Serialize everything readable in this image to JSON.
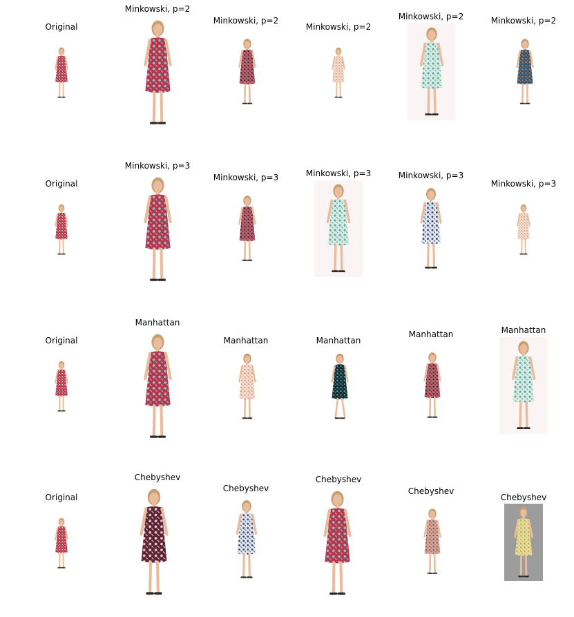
{
  "rows": [
    {
      "cells": [
        {
          "caption": "Original",
          "image": {
            "dress": "#b8344c",
            "pattern": "#e8d8c8",
            "bg": "#ffffff",
            "pose": "stand",
            "subject": "woman-in-red-floral-dress"
          }
        },
        {
          "caption": "Minkowski, p=2",
          "image": {
            "dress": "#b8344c",
            "pattern": "#86c8c8",
            "bg": "#ffffff",
            "pose": "stand",
            "subject": "woman-in-red-floral-dress"
          }
        },
        {
          "caption": "Minkowski, p=2",
          "image": {
            "dress": "#c06070",
            "pattern": "#222222",
            "bg": "#ffffff",
            "pose": "stand",
            "subject": "woman-in-zebra-print-dress"
          }
        },
        {
          "caption": "Minkowski, p=2",
          "image": {
            "dress": "#f0e0c8",
            "pattern": "#e08898",
            "bg": "#ffffff",
            "pose": "stand",
            "subject": "woman-in-cream-floral-dress"
          }
        },
        {
          "caption": "Minkowski, p=2",
          "image": {
            "dress": "#d8ece4",
            "pattern": "#5aa8a0",
            "bg": "#faf4f4",
            "pose": "stand",
            "subject": "woman-in-mint-print-dress"
          }
        },
        {
          "caption": "Minkowski, p=2",
          "image": {
            "dress": "#2c5878",
            "pattern": "#d88050",
            "bg": "#ffffff",
            "pose": "stand",
            "subject": "woman-in-blue-floral-dress"
          }
        }
      ]
    },
    {
      "cells": [
        {
          "caption": "Original",
          "image": {
            "dress": "#b8344c",
            "pattern": "#e8d8c8",
            "bg": "#ffffff",
            "pose": "stand",
            "subject": "woman-in-red-floral-dress"
          }
        },
        {
          "caption": "Minkowski, p=3",
          "image": {
            "dress": "#b8344c",
            "pattern": "#86c8c8",
            "bg": "#ffffff",
            "pose": "stand",
            "subject": "woman-in-red-floral-dress"
          }
        },
        {
          "caption": "Minkowski, p=3",
          "image": {
            "dress": "#c06070",
            "pattern": "#222222",
            "bg": "#ffffff",
            "pose": "stand",
            "subject": "woman-in-zebra-print-dress"
          }
        },
        {
          "caption": "Minkowski, p=3",
          "image": {
            "dress": "#d8ece4",
            "pattern": "#5aa8a0",
            "bg": "#faf4f4",
            "pose": "stand",
            "subject": "woman-in-mint-print-dress"
          }
        },
        {
          "caption": "Minkowski, p=3",
          "image": {
            "dress": "#e4e8f0",
            "pattern": "#2c3c6c",
            "bg": "#ffffff",
            "pose": "stand",
            "subject": "woman-in-navy-print-dress"
          }
        },
        {
          "caption": "Minkowski, p=3",
          "image": {
            "dress": "#f0e0c8",
            "pattern": "#e08898",
            "bg": "#ffffff",
            "pose": "stand",
            "subject": "woman-in-cream-floral-dress"
          }
        }
      ]
    },
    {
      "cells": [
        {
          "caption": "Original",
          "image": {
            "dress": "#b8344c",
            "pattern": "#e8d8c8",
            "bg": "#ffffff",
            "pose": "stand",
            "subject": "woman-in-red-floral-dress"
          }
        },
        {
          "caption": "Manhattan",
          "image": {
            "dress": "#b8344c",
            "pattern": "#86c8c8",
            "bg": "#ffffff",
            "pose": "stand",
            "subject": "woman-in-red-floral-dress"
          }
        },
        {
          "caption": "Manhattan",
          "image": {
            "dress": "#f0e0c8",
            "pattern": "#e08898",
            "bg": "#ffffff",
            "pose": "stand",
            "subject": "woman-in-cream-floral-dress"
          }
        },
        {
          "caption": "Manhattan",
          "image": {
            "dress": "#1c2430",
            "pattern": "#40c0b0",
            "bg": "#ffffff",
            "pose": "walk",
            "subject": "woman-in-dark-print-dress"
          }
        },
        {
          "caption": "Manhattan",
          "image": {
            "dress": "#c06070",
            "pattern": "#222222",
            "bg": "#ffffff",
            "pose": "stand",
            "subject": "woman-in-zebra-print-dress"
          }
        },
        {
          "caption": "Manhattan",
          "image": {
            "dress": "#d8ece4",
            "pattern": "#5aa8a0",
            "bg": "#faf4f4",
            "pose": "stand",
            "subject": "woman-in-mint-print-dress"
          }
        }
      ]
    },
    {
      "cells": [
        {
          "caption": "Original",
          "image": {
            "dress": "#b8344c",
            "pattern": "#e8d8c8",
            "bg": "#ffffff",
            "pose": "stand",
            "subject": "woman-in-red-floral-dress"
          }
        },
        {
          "caption": "Chebyshev",
          "image": {
            "dress": "#5a2434",
            "pattern": "#e8c8cc",
            "bg": "#ffffff",
            "pose": "stand",
            "subject": "woman-in-burgundy-dress"
          }
        },
        {
          "caption": "Chebyshev",
          "image": {
            "dress": "#e4e8f0",
            "pattern": "#2c3c6c",
            "bg": "#ffffff",
            "pose": "stand",
            "subject": "woman-in-navy-print-dress"
          }
        },
        {
          "caption": "Chebyshev",
          "image": {
            "dress": "#b8344c",
            "pattern": "#86c8c8",
            "bg": "#ffffff",
            "pose": "stand",
            "subject": "woman-in-red-floral-dress"
          }
        },
        {
          "caption": "Chebyshev",
          "image": {
            "dress": "#d8a8a0",
            "pattern": "#7a4a3a",
            "bg": "#ffffff",
            "pose": "stand",
            "subject": "woman-in-brown-print-dress"
          }
        },
        {
          "caption": "Chebyshev",
          "image": {
            "dress": "#e8dc98",
            "pattern": "#b8a860",
            "bg": "#9c9c9c",
            "pose": "stand",
            "subject": "woman-in-yellow-dress"
          }
        }
      ]
    }
  ]
}
